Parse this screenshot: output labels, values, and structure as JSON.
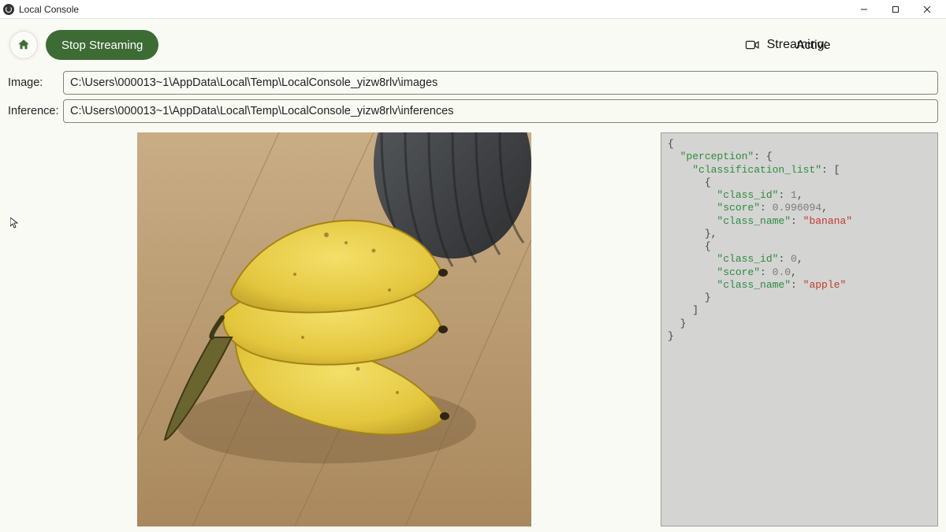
{
  "window": {
    "title": "Local Console"
  },
  "toolbar": {
    "stop_label": "Stop Streaming"
  },
  "status": {
    "label": "Streaming:",
    "value": "Active"
  },
  "paths": {
    "image_label": "Image:",
    "image_value": "C:\\Users\\000013~1\\AppData\\Local\\Temp\\LocalConsole_yizw8rlv\\images",
    "inference_label": "Inference:",
    "inference_value": "C:\\Users\\000013~1\\AppData\\Local\\Temp\\LocalConsole_yizw8rlv\\inferences"
  },
  "inference_json": {
    "perception": {
      "classification_list": [
        {
          "class_id": 1,
          "score": 0.996094,
          "class_name": "banana"
        },
        {
          "class_id": 0,
          "score": 0.0,
          "class_name": "apple"
        }
      ]
    }
  },
  "json_display": {
    "l0": "{",
    "l1k": "\"perception\"",
    "l1r": ": {",
    "l2k": "\"classification_list\"",
    "l2r": ": [",
    "l3": "{",
    "l4k": "\"class_id\"",
    "l4v": "1",
    "l4r": ",",
    "l5k": "\"score\"",
    "l5v": "0.996094",
    "l5r": ",",
    "l6k": "\"class_name\"",
    "l6v": "\"banana\"",
    "l7": "},",
    "l8": "{",
    "l9k": "\"class_id\"",
    "l9v": "0",
    "l9r": ",",
    "l10k": "\"score\"",
    "l10v": "0.0",
    "l10r": ",",
    "l11k": "\"class_name\"",
    "l11v": "\"apple\"",
    "l12": "}",
    "l13": "]",
    "l14": "}",
    "l15": "}"
  }
}
